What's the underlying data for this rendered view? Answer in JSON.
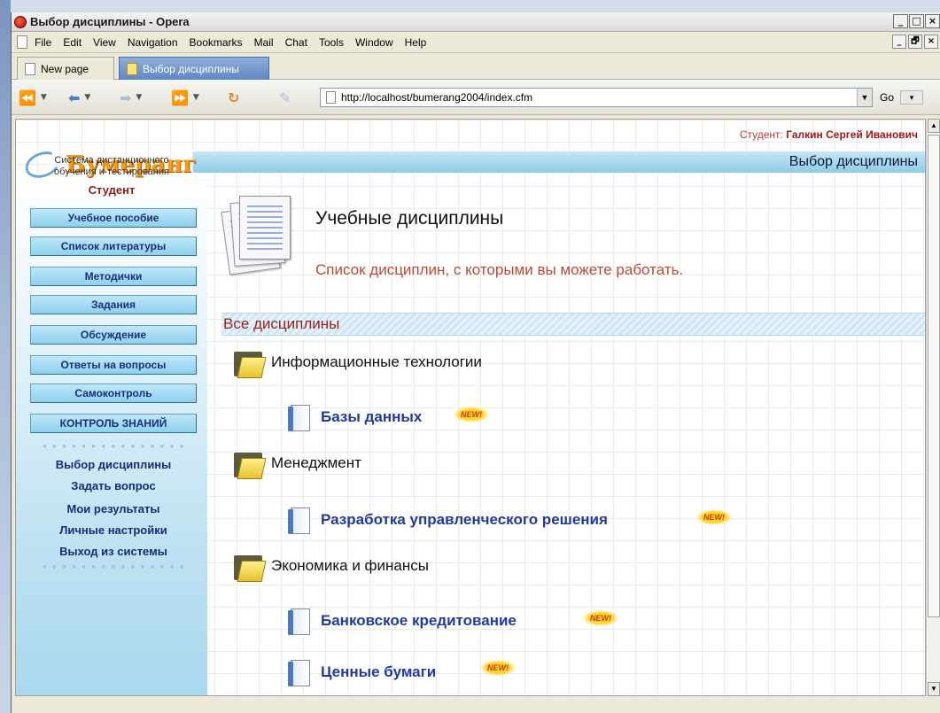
{
  "window": {
    "title": "Выбор дисциплины - Opera",
    "controls": [
      "_",
      "□",
      "×"
    ]
  },
  "menubar": {
    "items": [
      {
        "label": "File",
        "access_key": "F"
      },
      {
        "label": "Edit",
        "access_key": "E"
      },
      {
        "label": "View",
        "access_key": "V"
      },
      {
        "label": "Navigation",
        "access_key": "N"
      },
      {
        "label": "Bookmarks",
        "access_key": "B"
      },
      {
        "label": "Mail",
        "access_key": "M"
      },
      {
        "label": "Chat",
        "access_key": "C"
      },
      {
        "label": "Tools",
        "access_key": "T"
      },
      {
        "label": "Window",
        "access_key": "W"
      },
      {
        "label": "Help",
        "access_key": "H"
      }
    ],
    "right_controls": [
      "_",
      "🗗",
      "×"
    ]
  },
  "tabs": [
    {
      "label": "New page",
      "active": false
    },
    {
      "label": "Выбор дисциплины",
      "active": true
    }
  ],
  "toolbar": {
    "url": "http://localhost/bumerang2004/index.cfm",
    "go_label": "Go",
    "icons": [
      "rewind-icon",
      "back-icon",
      "forward-icon",
      "fast-forward-icon",
      "reload-icon",
      "edit-icon"
    ]
  },
  "page": {
    "student_label": "Студент:",
    "student_name": "Галкин Сергей Иванович",
    "brand": "Бумеранг",
    "header_title": "Выбор дисциплины",
    "system_name_line1": "Система дистанционного",
    "system_name_line2": "обучения и тестирования",
    "role": "Студент",
    "nav_buttons": [
      "Учебное пособие",
      "Список литературы",
      "Методички",
      "Задания",
      "Обсуждение",
      "Ответы на вопросы",
      "Самоконтроль",
      "КОНТРОЛЬ ЗНАНИЙ"
    ],
    "links": [
      "Выбор дисциплины",
      "Задать вопрос",
      "Мои результаты",
      "Личные настройки",
      "Выход из системы"
    ],
    "main_title": "Учебные дисциплины",
    "main_subtitle": "Список дисциплин, с которыми вы можете работать.",
    "section_title": "Все дисциплины",
    "categories": [
      {
        "name": "Информационные технологии",
        "disciplines": [
          {
            "name": "Базы данных",
            "badge": "NEW!"
          }
        ]
      },
      {
        "name": "Менеджмент",
        "disciplines": [
          {
            "name": "Разработка управленческого решения",
            "badge": "NEW!"
          }
        ]
      },
      {
        "name": "Экономика и финансы",
        "disciplines": [
          {
            "name": "Банковское кредитование",
            "badge": "NEW!"
          },
          {
            "name": "Ценные бумаги",
            "badge": "NEW!"
          }
        ]
      }
    ]
  },
  "colors": {
    "accent_blue": "#8fcbe8",
    "brand_orange": "#f39a1a",
    "link_blue": "#213a9e",
    "subtitle_red": "#b84a38"
  }
}
